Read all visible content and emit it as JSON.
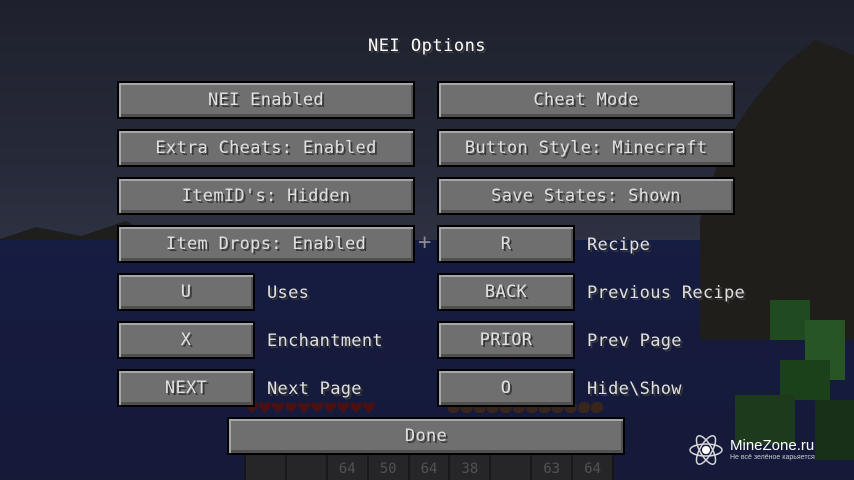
{
  "screen": {
    "title": "NEI Options"
  },
  "buttons": {
    "nei_enabled": "NEI Enabled",
    "cheat_mode": "Cheat Mode",
    "extra_cheats": "Extra Cheats: Enabled",
    "button_style": "Button Style: Minecraft",
    "item_ids": "ItemID's: Hidden",
    "save_states": "Save States: Shown",
    "item_drops": "Item Drops: Enabled",
    "done": "Done"
  },
  "keybinds": [
    {
      "key": "R",
      "action": "Recipe"
    },
    {
      "key": "U",
      "action": "Uses"
    },
    {
      "key": "BACK",
      "action": "Previous Recipe"
    },
    {
      "key": "X",
      "action": "Enchantment"
    },
    {
      "key": "PRIOR",
      "action": "Prev Page"
    },
    {
      "key": "NEXT",
      "action": "Next Page"
    },
    {
      "key": "O",
      "action": "Hide\\Show"
    }
  ],
  "hud": {
    "hotbar_counts": [
      "",
      "",
      "64",
      "50",
      "64",
      "38",
      "",
      "63",
      "64"
    ]
  },
  "watermark": {
    "site": "MineZone.ru",
    "tagline": "Не всё зелёное карьяется"
  }
}
